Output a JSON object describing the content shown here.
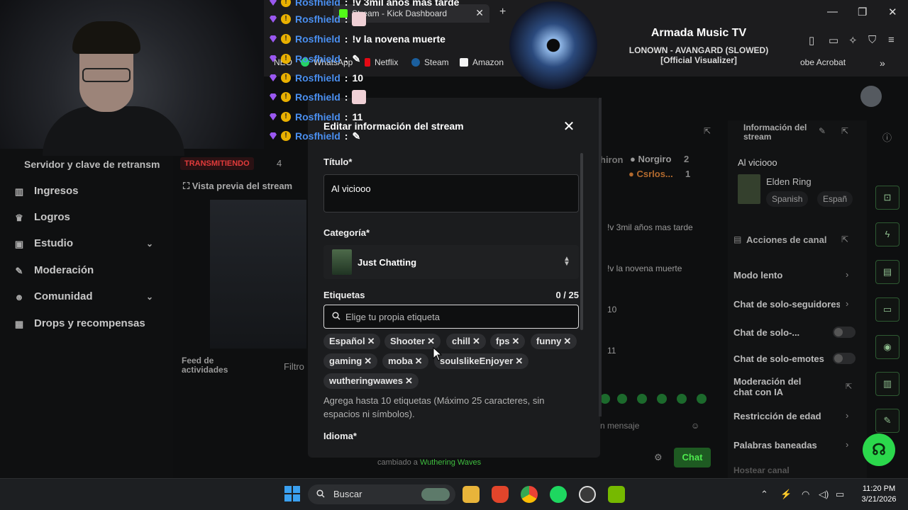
{
  "browser": {
    "tab_title": "Stream - Kick Dashboard",
    "bookmarks": [
      {
        "label": "WhatsApp",
        "color": "#25d366"
      },
      {
        "label": "Netflix",
        "color": "#e50914"
      },
      {
        "label": "Steam",
        "color": "#1b5f9e"
      },
      {
        "label": "Amazon",
        "color": "#f3f3f3"
      }
    ],
    "bookmark_partial_left": "NEO",
    "bookmark_partial_right": "obe Acrobat"
  },
  "webcam_overlay": {
    "chat_lines": [
      {
        "user": "Rosfhield",
        "msg": "!v 3mil años mas tarde",
        "emote": false
      },
      {
        "user": "Rosfhield",
        "msg": "",
        "emote": true
      },
      {
        "user": "Rosfhield",
        "msg": "!v la novena muerte",
        "emote": false
      },
      {
        "user": "Rosfhield",
        "msg": "",
        "emote": "hand"
      },
      {
        "user": "Rosfhield",
        "msg": "10",
        "emote": false
      },
      {
        "user": "Rosfhield",
        "msg": "",
        "emote": true
      },
      {
        "user": "Rosfhield",
        "msg": "11",
        "emote": false
      },
      {
        "user": "Rosfhield",
        "msg": "",
        "emote": "hand"
      }
    ]
  },
  "music": {
    "artist": "Armada Music TV",
    "track": "LONOWN - AVANGARD (SLOWED) [Official Visualizer]"
  },
  "dashboard": {
    "server_key_label": "Servidor y clave de retransm",
    "live_badge": "TRANSMITIENDO",
    "viewer_count": "4",
    "preview_label": "Vista previa del stream",
    "nav": [
      {
        "label": "Ingresos",
        "icon": "chart-icon"
      },
      {
        "label": "Logros",
        "icon": "trophy-icon"
      },
      {
        "label": "Estudio",
        "icon": "studio-icon",
        "expand": true
      },
      {
        "label": "Moderación",
        "icon": "wrench-icon"
      },
      {
        "label": "Comunidad",
        "icon": "people-icon",
        "expand": true
      },
      {
        "label": "Drops y recompensas",
        "icon": "gift-icon"
      }
    ],
    "activity_feed_label": "Feed de actividades",
    "filter_label": "Filtro",
    "chat": {
      "users": [
        {
          "name": "Norgiro",
          "count": "2",
          "color": "#9a9a9a"
        },
        {
          "name": "Csrlos...",
          "count": "1",
          "color": "#b36a2e"
        }
      ],
      "partial_user": "hiron",
      "messages": [
        "!v 3mil años mas tarde",
        "!v la novena muerte",
        "10",
        "11"
      ],
      "input_placeholder": "n mensaje",
      "send_label": "Chat",
      "event_text": "cambiado a",
      "event_game": "Wuthering Waves"
    },
    "info": {
      "title": "Información del stream",
      "stream_title": "Al viciooo",
      "game": "Elden Ring",
      "chips": [
        "Spanish",
        "Españ"
      ]
    },
    "actions": {
      "title": "Acciones de canal",
      "items": [
        {
          "label": "Modo lento",
          "control": "chevron"
        },
        {
          "label": "Chat de solo-seguidores",
          "control": "chevron"
        },
        {
          "label": "Chat de solo-...",
          "control": "toggle"
        },
        {
          "label": "Chat de solo-emotes",
          "control": "toggle"
        },
        {
          "label": "Moderación del chat con IA",
          "control": "external"
        },
        {
          "label": "Restricción de edad",
          "control": "chevron"
        },
        {
          "label": "Palabras baneadas",
          "control": "chevron"
        },
        {
          "label": "Hostear canal",
          "control": "none"
        }
      ]
    }
  },
  "modal": {
    "title": "Editar información del stream",
    "title_label": "Título*",
    "title_value": "Al viciooo",
    "category_label": "Categoría*",
    "category_value": "Just Chatting",
    "tags_label": "Etiquetas",
    "tags_count": "0 / 25",
    "tags_placeholder": "Elige tu propia etiqueta",
    "tags": [
      "Español",
      "Shooter",
      "chill",
      "fps",
      "funny",
      "gaming",
      "moba",
      "soulslikeEnjoyer",
      "wutheringwawes"
    ],
    "tags_help": "Agrega hasta 10 etiquetas (Máximo 25 caracteres, sin espacios ni símbolos).",
    "language_label": "Idioma*"
  },
  "taskbar": {
    "search_placeholder": "Buscar",
    "time": "11:20 PM",
    "date": "3/21/2026",
    "apps": [
      "file-explorer-icon",
      "brave-icon",
      "chrome-icon",
      "spotify-icon",
      "obs-icon",
      "nvidia-icon"
    ]
  }
}
